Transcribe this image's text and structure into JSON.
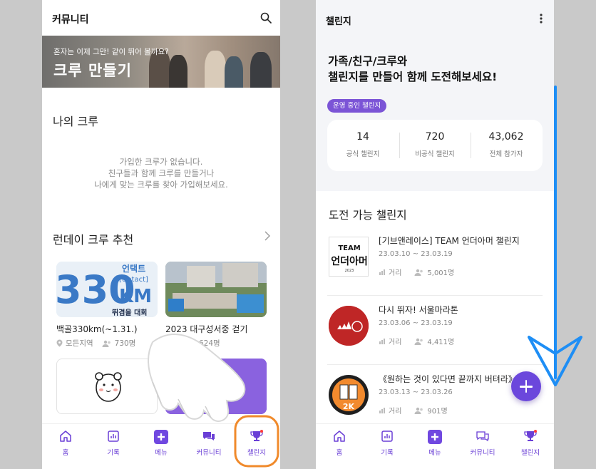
{
  "left": {
    "title": "커뮤니티",
    "banner": {
      "subtitle": "혼자는 이제 그만! 같이 뛰어 볼까요?",
      "title": "크루 만들기"
    },
    "my_crew": {
      "heading": "나의 크루",
      "empty_lines": [
        "가입한 크루가 없습니다.",
        "친구들과 함께 크루를 만들거나",
        "나에게 맞는 크루를 찾아 가입해보세요."
      ]
    },
    "recommend": {
      "heading": "런데이 크루 추천",
      "cards": [
        {
          "name": "백골330km(~1.31.)",
          "region": "모든지역",
          "members": "730명",
          "thumb_lines": [
            "330",
            "언택트",
            "[Untact]",
            "KM",
            "뛰겸을 대회"
          ]
        },
        {
          "name": "2023 대구성서중 걷기",
          "members": "624명"
        }
      ]
    },
    "nav": [
      "홈",
      "기록",
      "메뉴",
      "커뮤니티",
      "챌린지"
    ]
  },
  "right": {
    "title": "챌린지",
    "headline": [
      "가족/친구/크루와",
      "챌린지를 만들어 함께 도전해보세요!"
    ],
    "pill": "운영 중인 챌린지",
    "stats": [
      {
        "num": "14",
        "cap": "공식 챌린지"
      },
      {
        "num": "720",
        "cap": "비공식 챌린지"
      },
      {
        "num": "43,062",
        "cap": "전체 참가자"
      }
    ],
    "section": "도전 가능 챌린지",
    "challenges": [
      {
        "title": "[기브앤레이스] TEAM 언더아머 챌린지",
        "date": "23.03.10 ~ 23.03.19",
        "kind": "거리",
        "count": "5,001명",
        "thumb_text": [
          "TEAM",
          "언더아머",
          "2023"
        ]
      },
      {
        "title": "다시 뛰자! 서울마라톤",
        "date": "23.03.06 ~ 23.03.19",
        "kind": "거리",
        "count": "4,411명"
      },
      {
        "title": "《원하는 것이 있다면 끝까지 버텨라》",
        "date": "23.03.13 ~ 23.03.26",
        "kind": "거리",
        "count": "901명",
        "thumb_text": "2K"
      }
    ],
    "nav": [
      "홈",
      "기록",
      "메뉴",
      "커뮤니티",
      "챌린지"
    ]
  },
  "colors": {
    "brand": "#6b47dc",
    "highlight": "#f08a2b",
    "arrow": "#1e8ef5"
  }
}
